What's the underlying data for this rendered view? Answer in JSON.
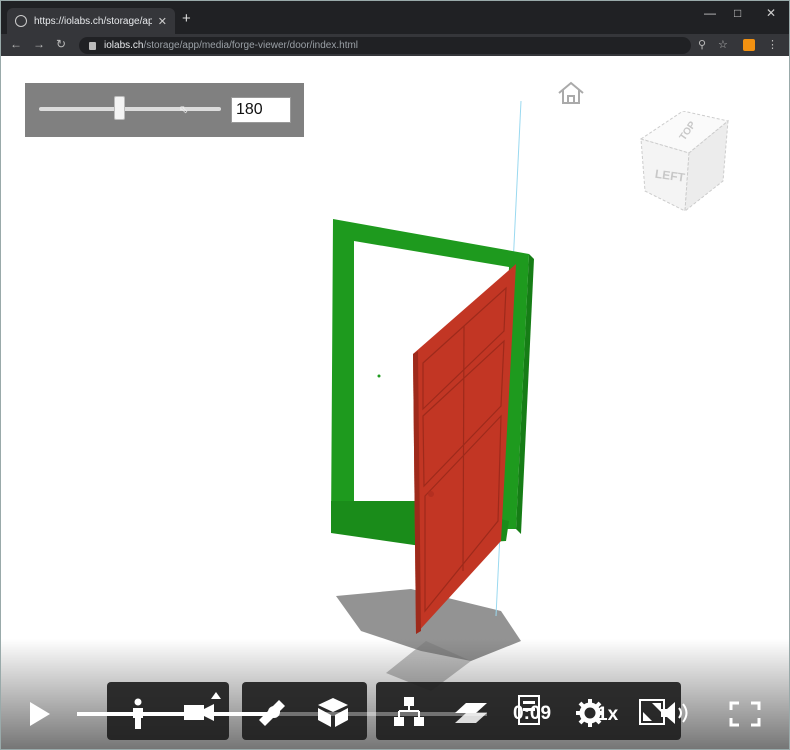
{
  "browser": {
    "tab_title": "https://iolabs.ch/storage/app/m",
    "tab_close": "✕",
    "new_tab": "+",
    "url_host": "iolabs.ch",
    "url_path": "/storage/app/media/forge-viewer/door/index.html"
  },
  "viewer": {
    "slider": {
      "value_text": "180",
      "position_fraction": 0.44
    },
    "view_cube": {
      "front_label": "LEFT",
      "top_label": "TOP"
    },
    "colors": {
      "frame": "#1e9a1e",
      "door": "#c23624",
      "panel": "#808080",
      "axis_line": "#9ad9f0"
    }
  },
  "video": {
    "current_time": "0:09",
    "speed": "1x",
    "progress_fraction": 0.48
  },
  "icons": {
    "play": "play-icon",
    "person": "first-person-icon",
    "camera": "camera-icon",
    "measure": "measure-icon",
    "box": "explode-icon",
    "tree": "model-browser-icon",
    "layers": "layers-icon",
    "properties": "properties-icon",
    "settings": "gear-icon",
    "fullscreen_viewer": "viewer-fullscreen-icon",
    "volume": "volume-icon",
    "fullscreen": "fullscreen-icon",
    "home": "home-icon"
  }
}
